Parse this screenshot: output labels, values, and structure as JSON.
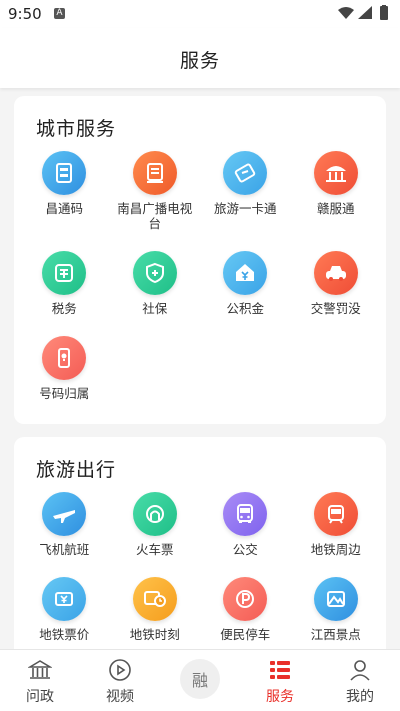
{
  "status_bar": {
    "time": "9:50",
    "notification_letter": "A"
  },
  "header": {
    "title": "服务"
  },
  "sections": [
    {
      "title": "城市服务",
      "items": [
        {
          "label": "昌通码",
          "icon": "transit-card-icon",
          "color": "blue"
        },
        {
          "label": "南昌广播电视台",
          "icon": "tv-station-icon",
          "color": "orange"
        },
        {
          "label": "旅游一卡通",
          "icon": "ticket-icon",
          "color": "lightblue"
        },
        {
          "label": "赣服通",
          "icon": "government-building-icon",
          "color": "red"
        },
        {
          "label": "税务",
          "icon": "tax-icon",
          "color": "green"
        },
        {
          "label": "社保",
          "icon": "social-security-icon",
          "color": "green"
        },
        {
          "label": "公积金",
          "icon": "housing-fund-icon",
          "color": "lightblue"
        },
        {
          "label": "交警罚没",
          "icon": "traffic-police-car-icon",
          "color": "red"
        },
        {
          "label": "号码归属",
          "icon": "phone-location-icon",
          "color": "coral"
        }
      ]
    },
    {
      "title": "旅游出行",
      "items": [
        {
          "label": "飞机航班",
          "icon": "airplane-icon",
          "color": "blue"
        },
        {
          "label": "火车票",
          "icon": "train-icon",
          "color": "green"
        },
        {
          "label": "公交",
          "icon": "bus-icon",
          "color": "purple"
        },
        {
          "label": "地铁周边",
          "icon": "metro-nearby-icon",
          "color": "red"
        },
        {
          "label": "地铁票价",
          "icon": "metro-fare-icon",
          "color": "lightblue"
        },
        {
          "label": "地铁时刻",
          "icon": "metro-schedule-icon",
          "color": "yellow"
        },
        {
          "label": "便民停车",
          "icon": "parking-icon",
          "color": "coral"
        },
        {
          "label": "江西景点",
          "icon": "scenic-spot-icon",
          "color": "blue"
        }
      ]
    }
  ],
  "bottom_nav": [
    {
      "label": "问政",
      "icon": "government-icon",
      "active": false
    },
    {
      "label": "视频",
      "icon": "play-icon",
      "active": false
    },
    {
      "label": "",
      "icon_text": "融",
      "icon": "center-logo-icon",
      "active": false
    },
    {
      "label": "服务",
      "icon": "service-list-icon",
      "active": true
    },
    {
      "label": "我的",
      "icon": "person-icon",
      "active": false
    }
  ],
  "colors": {
    "accent": "#e9302a",
    "background": "#f4f4f4",
    "card": "#ffffff"
  }
}
